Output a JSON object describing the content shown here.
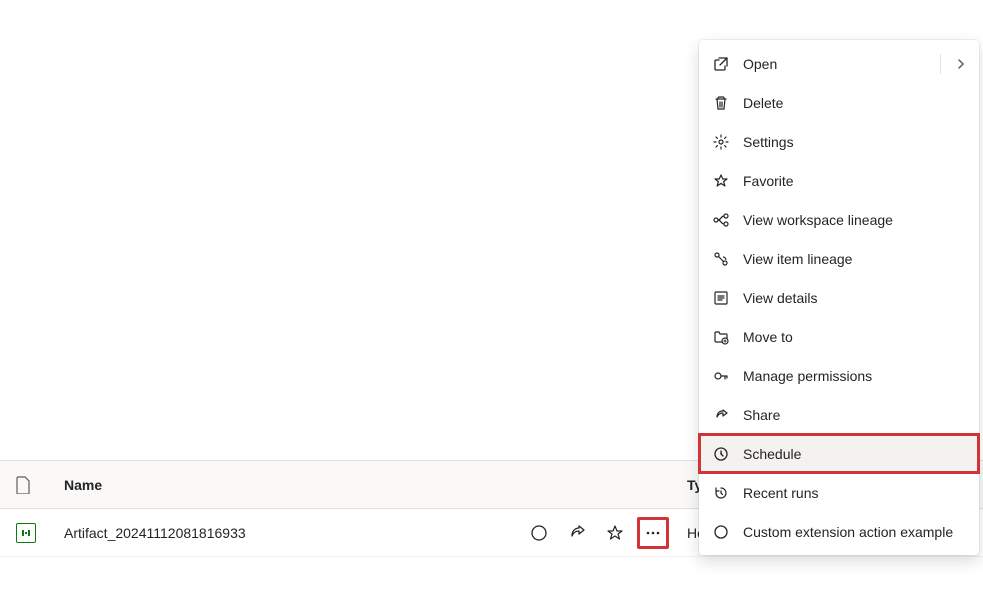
{
  "table": {
    "headers": {
      "name": "Name",
      "type": "Type"
    },
    "rows": [
      {
        "name": "Artifact_20241112081816933",
        "type": "HomeOne",
        "extra": "—"
      }
    ]
  },
  "contextMenu": {
    "items": [
      {
        "label": "Open",
        "icon": "open",
        "hasSubmenu": true
      },
      {
        "label": "Delete",
        "icon": "delete"
      },
      {
        "label": "Settings",
        "icon": "settings"
      },
      {
        "label": "Favorite",
        "icon": "favorite"
      },
      {
        "label": "View workspace lineage",
        "icon": "lineage"
      },
      {
        "label": "View item lineage",
        "icon": "item-lineage"
      },
      {
        "label": "View details",
        "icon": "details"
      },
      {
        "label": "Move to",
        "icon": "move"
      },
      {
        "label": "Manage permissions",
        "icon": "permissions"
      },
      {
        "label": "Share",
        "icon": "share"
      },
      {
        "label": "Schedule",
        "icon": "schedule",
        "highlighted": true
      },
      {
        "label": "Recent runs",
        "icon": "recent"
      },
      {
        "label": "Custom extension action example",
        "icon": "custom"
      }
    ]
  }
}
